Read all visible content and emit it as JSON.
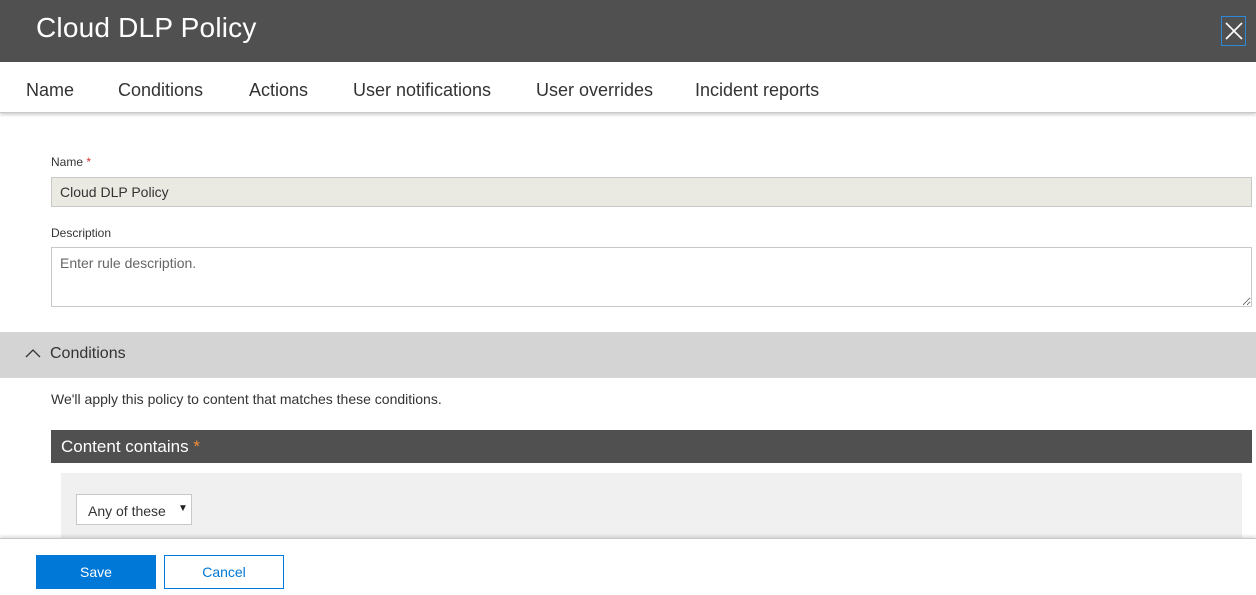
{
  "header": {
    "title": "Cloud DLP Policy",
    "close_icon": "close-icon"
  },
  "tabs": [
    {
      "label": "Name"
    },
    {
      "label": "Conditions"
    },
    {
      "label": "Actions"
    },
    {
      "label": "User notifications"
    },
    {
      "label": "User overrides"
    },
    {
      "label": "Incident reports"
    }
  ],
  "form": {
    "name_label": "Name",
    "required_mark": "*",
    "name_value": "Cloud DLP Policy",
    "description_label": "Description",
    "description_placeholder": "Enter rule description."
  },
  "conditions_section": {
    "title": "Conditions",
    "icon": "chevron-up-icon",
    "description": "We'll apply this policy to content that matches these conditions.",
    "content_contains_title": "Content contains",
    "content_contains_required": "*",
    "match_select_value": "Any of these",
    "match_select_icon": "caret-down-icon"
  },
  "footer": {
    "save_label": "Save",
    "cancel_label": "Cancel"
  },
  "colors": {
    "header_bg": "#505050",
    "accent": "#0078d7",
    "required": "#d13438",
    "section_bg": "#d4d4d4"
  }
}
